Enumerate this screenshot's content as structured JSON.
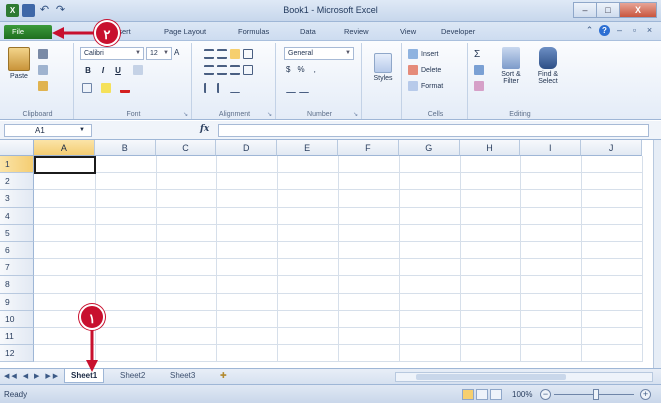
{
  "window": {
    "title": "Book1 - Microsoft Excel",
    "app_icon": "excel-icon",
    "minimize": "–",
    "maximize": "□",
    "close": "X"
  },
  "ribbon_tabs": [
    {
      "label": "File"
    },
    {
      "label": "Insert"
    },
    {
      "label": "Page Layout"
    },
    {
      "label": "Formulas"
    },
    {
      "label": "Data"
    },
    {
      "label": "Review"
    },
    {
      "label": "View"
    },
    {
      "label": "Developer"
    }
  ],
  "ribbon": {
    "clipboard": {
      "label": "Clipboard",
      "paste": "Paste"
    },
    "font": {
      "label": "Font",
      "name": "Calibri",
      "size": "12",
      "bold": "B",
      "italic": "I",
      "underline": "U"
    },
    "alignment": {
      "label": "Alignment"
    },
    "number": {
      "label": "Number",
      "format": "General",
      "currency": "$",
      "percent": "%",
      "comma": ","
    },
    "styles": {
      "label": "Styles"
    },
    "cells": {
      "label": "Cells",
      "insert": "Insert",
      "delete": "Delete",
      "format": "Format"
    },
    "editing": {
      "label": "Editing",
      "sort": "Sort & Filter",
      "find": "Find & Select",
      "sum": "Σ"
    }
  },
  "formula_bar": {
    "name_box": "A1",
    "fx": "fx",
    "value": ""
  },
  "grid": {
    "columns": [
      "A",
      "B",
      "C",
      "D",
      "E",
      "F",
      "G",
      "H",
      "I",
      "J"
    ],
    "rows": [
      "1",
      "2",
      "3",
      "4",
      "5",
      "6",
      "7",
      "8",
      "9",
      "10",
      "11",
      "12"
    ],
    "active_cell": "A1"
  },
  "sheets": [
    {
      "label": "Sheet1",
      "active": true
    },
    {
      "label": "Sheet2",
      "active": false
    },
    {
      "label": "Sheet3",
      "active": false
    }
  ],
  "status": {
    "ready": "Ready",
    "zoom": "100%"
  },
  "callouts": {
    "one": "١",
    "two": "٢"
  },
  "colors": {
    "callout": "#c8102e",
    "file_tab": "#2a842a",
    "ribbon": "#e4ecf7"
  }
}
